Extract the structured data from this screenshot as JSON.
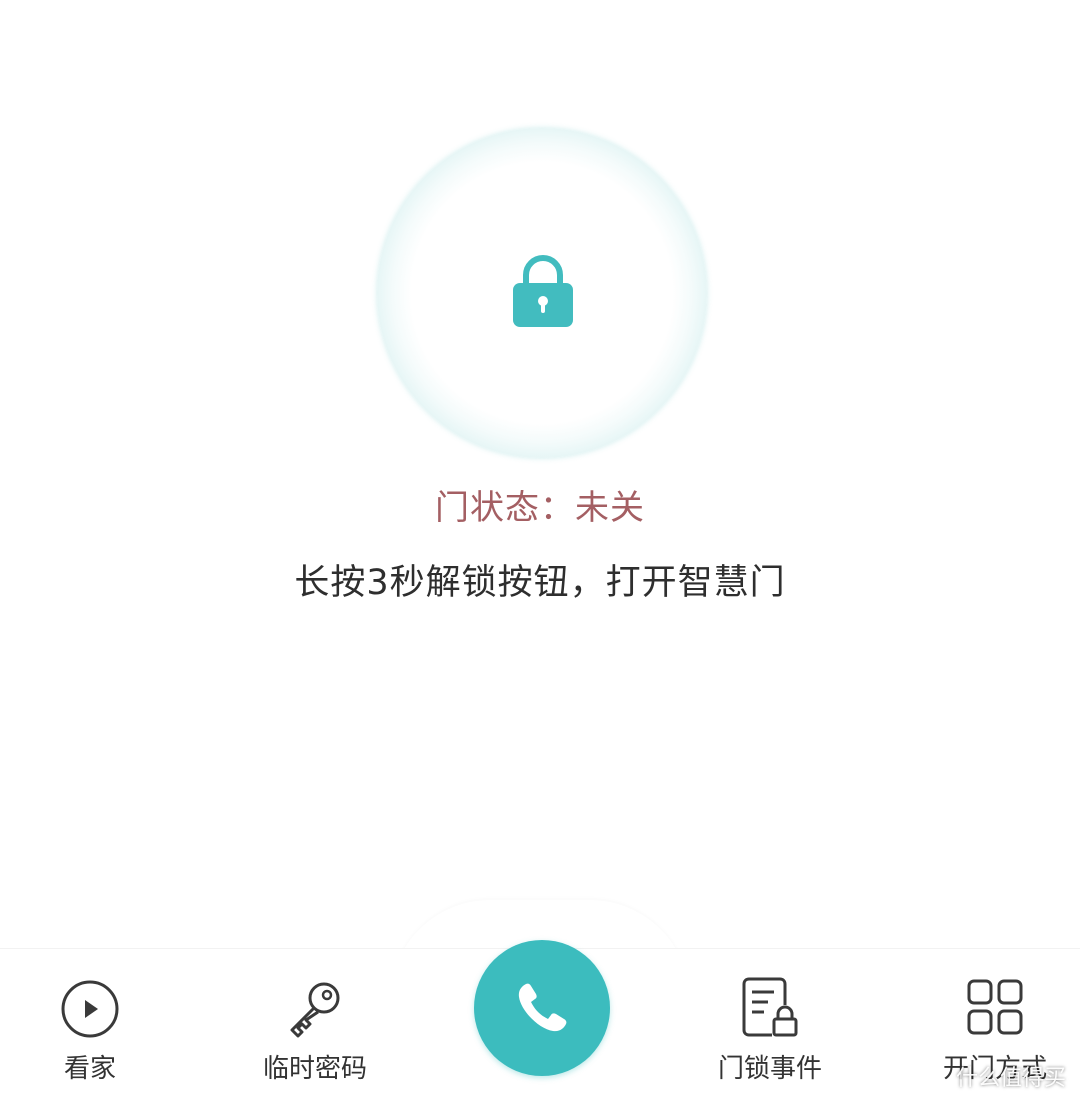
{
  "colors": {
    "accent": "#3cbcbe",
    "status_text": "#a45f63",
    "body_text": "#2e2e2e"
  },
  "lock_panel": {
    "icon": "padlock-icon",
    "door_status": "门状态：未关",
    "hint": "长按3秒解锁按钮，打开智慧门"
  },
  "bottom_nav": {
    "items": [
      {
        "label": "看家",
        "icon": "play-circle-icon"
      },
      {
        "label": "临时密码",
        "icon": "key-icon"
      },
      {
        "label": "门锁事件",
        "icon": "document-lock-icon"
      },
      {
        "label": "开门方式",
        "icon": "grid-icon"
      }
    ],
    "center": {
      "icon": "phone-icon"
    }
  },
  "watermark": "什么值得买"
}
